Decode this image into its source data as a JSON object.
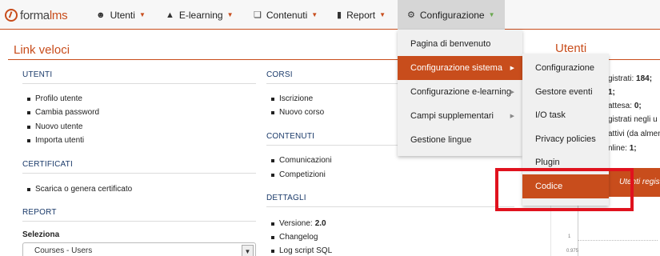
{
  "brand": {
    "logo_a": "forma",
    "logo_b": "lms"
  },
  "nav": [
    {
      "icon": "users-icon",
      "label": "Utenti"
    },
    {
      "icon": "graduation-cap-icon",
      "label": "E-learning"
    },
    {
      "icon": "copy-icon",
      "label": "Contenuti"
    },
    {
      "icon": "bar-chart-icon",
      "label": "Report"
    },
    {
      "icon": "cogs-icon",
      "label": "Configurazione"
    }
  ],
  "quicklinks": {
    "title": "Link veloci",
    "utenti": {
      "header": "UTENTI",
      "items": [
        "Profilo utente",
        "Cambia password",
        "Nuovo utente",
        "Importa utenti"
      ]
    },
    "certificati": {
      "header": "CERTIFICATI",
      "items": [
        "Scarica o genera certificato"
      ]
    },
    "report": {
      "header": "REPORT",
      "select_label": "Seleziona",
      "select_value": "Courses - Users"
    },
    "corsi": {
      "header": "CORSI",
      "items": [
        "Iscrizione",
        "Nuovo corso"
      ]
    },
    "contenuti": {
      "header": "CONTENUTI",
      "items": [
        "Comunicazioni",
        "Competizioni"
      ]
    },
    "dettagli": {
      "header": "DETTAGLI",
      "version_label": "Versione:",
      "version_value": "2.0",
      "items": [
        "Changelog",
        "Log script SQL"
      ]
    }
  },
  "right_panel": {
    "title": "Utenti",
    "stats": [
      {
        "label": "gistrati:",
        "value": "184;"
      },
      {
        "label": "",
        "value": "1;"
      },
      {
        "label": "attesa:",
        "value": "0;"
      },
      {
        "label": "gistrati negli u",
        "value": ""
      },
      {
        "label": "attivi (da almen",
        "value": ""
      },
      {
        "label": "nline:",
        "value": "1;"
      }
    ],
    "button": "Utenti regis",
    "chart_ticks": [
      "1",
      "0.975"
    ]
  },
  "menu_config": {
    "items": [
      "Pagina di benvenuto",
      "Configurazione sistema",
      "Configurazione e-learning",
      "Campi supplementari",
      "Gestione lingue"
    ],
    "submenu_indicator": "▶"
  },
  "submenu_sistema": {
    "items": [
      "Configurazione",
      "Gestore eventi",
      "I/O task",
      "Privacy policies",
      "Plugin",
      "Codice"
    ]
  },
  "colors": {
    "accent": "#c84d1c",
    "highlight": "#e0121e"
  }
}
